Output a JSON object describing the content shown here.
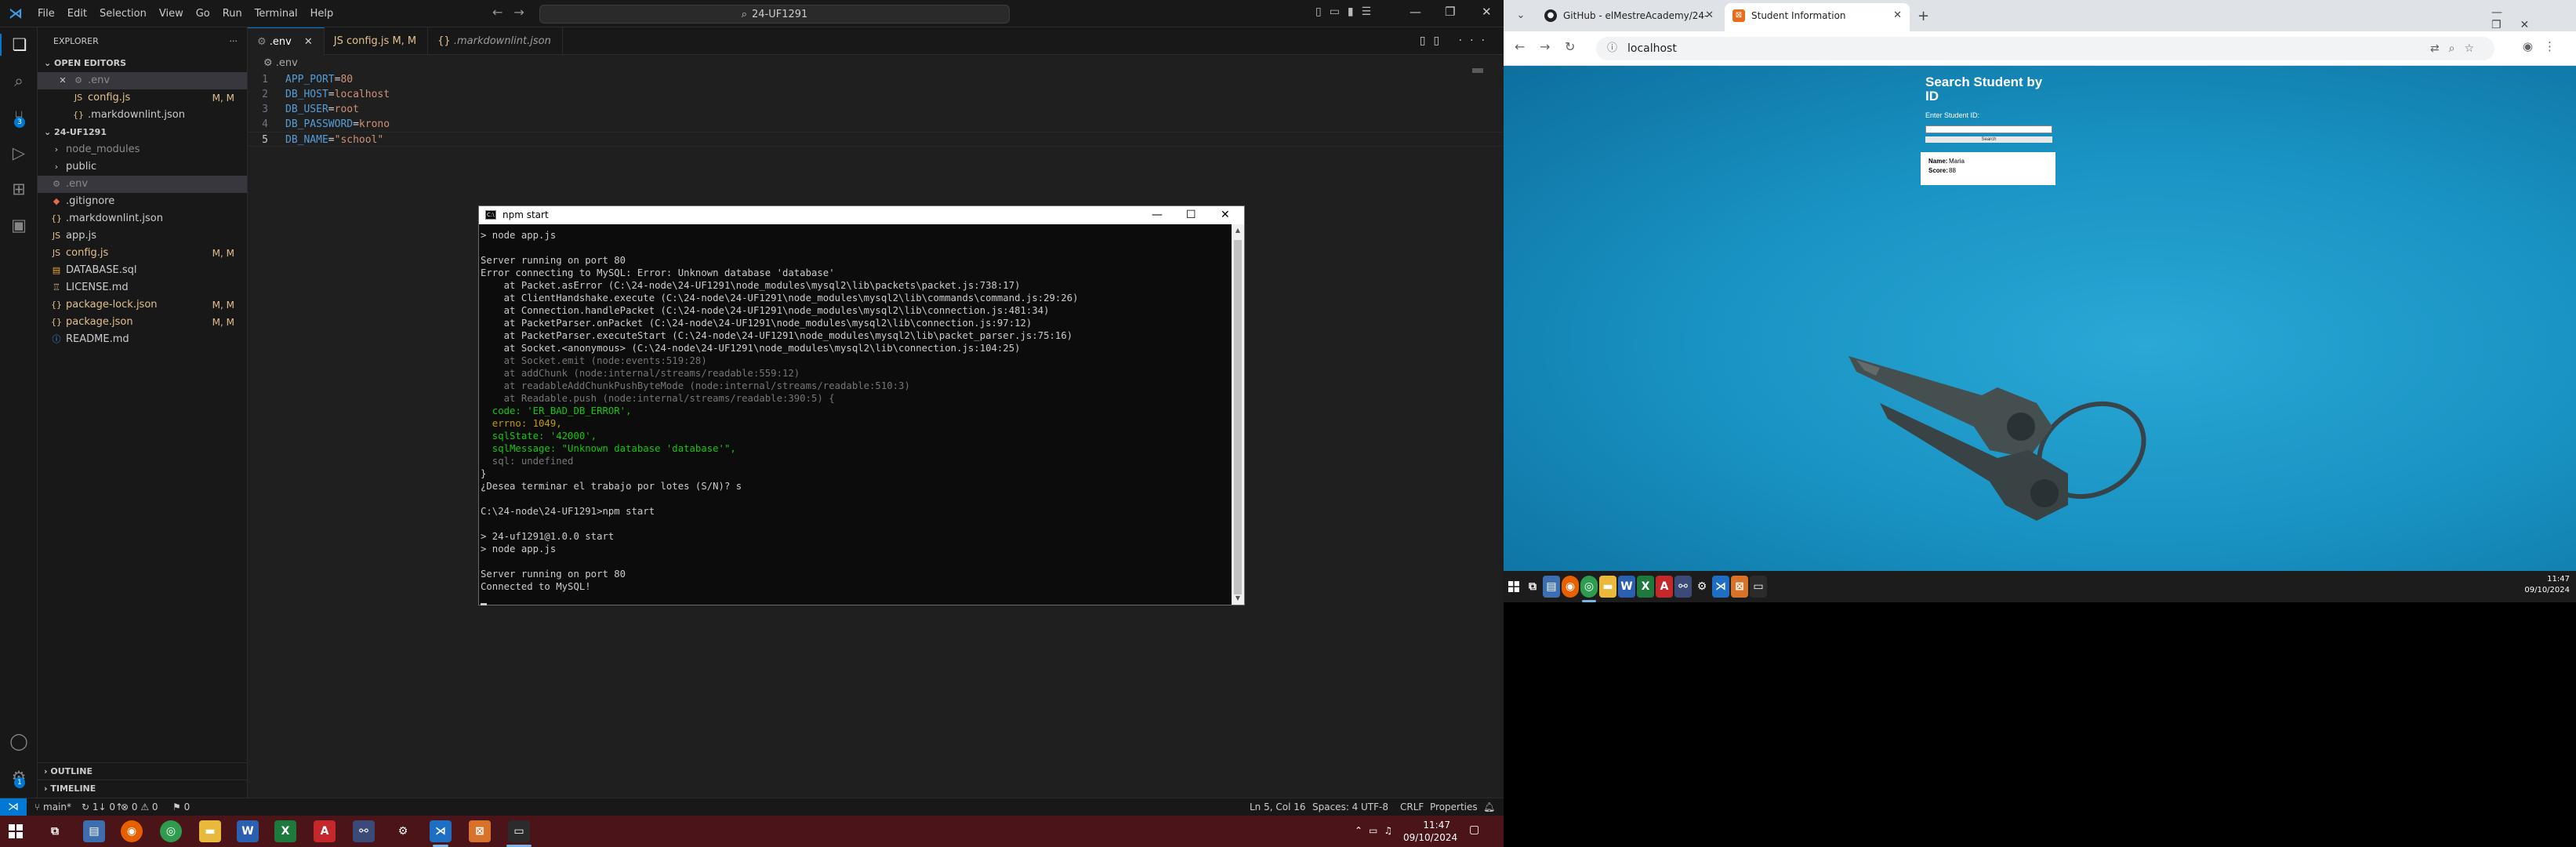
{
  "vscode": {
    "menu": [
      "File",
      "Edit",
      "Selection",
      "View",
      "Go",
      "Run",
      "Terminal",
      "Help"
    ],
    "search_box": "24-UF1291",
    "explorer_title": "EXPLORER",
    "open_editors_label": "OPEN EDITORS",
    "open_editors": [
      {
        "name": ".env",
        "status": "",
        "active": true
      },
      {
        "name": "config.js",
        "status": "M, M"
      },
      {
        "name": ".markdownlint.json",
        "status": ""
      }
    ],
    "workspace_label": "24-UF1291",
    "tree": [
      {
        "name": "node_modules",
        "type": "folder"
      },
      {
        "name": "public",
        "type": "folder"
      },
      {
        "name": ".env",
        "type": "file",
        "selected": true
      },
      {
        "name": ".gitignore",
        "type": "file"
      },
      {
        "name": ".markdownlint.json",
        "type": "file"
      },
      {
        "name": "app.js",
        "type": "file"
      },
      {
        "name": "config.js",
        "type": "file",
        "status": "M, M"
      },
      {
        "name": "DATABASE.sql",
        "type": "file"
      },
      {
        "name": "LICENSE.md",
        "type": "file"
      },
      {
        "name": "package-lock.json",
        "type": "file",
        "status": "M, M"
      },
      {
        "name": "package.json",
        "type": "file",
        "status": "M, M"
      },
      {
        "name": "README.md",
        "type": "file"
      }
    ],
    "outline_label": "OUTLINE",
    "timeline_label": "TIMELINE",
    "tabs": [
      {
        "label": ".env",
        "active": true
      },
      {
        "label": "config.js",
        "status": "M, M"
      },
      {
        "label": ".markdownlint.json"
      }
    ],
    "breadcrumb": ".env",
    "code": [
      {
        "n": "1",
        "key": "APP_PORT",
        "val": "80"
      },
      {
        "n": "2",
        "key": "DB_HOST",
        "val": "localhost"
      },
      {
        "n": "3",
        "key": "DB_USER",
        "val": "root"
      },
      {
        "n": "4",
        "key": "DB_PASSWORD",
        "val": "krono"
      },
      {
        "n": "5",
        "key": "DB_NAME",
        "val": "\"school\""
      }
    ],
    "status": {
      "branch": "main*",
      "sync": "↻ 1↓ 0↑",
      "problems": "⊗ 0 ⚠ 0",
      "ports": "⚑ 0",
      "position": "Ln 5, Col 16",
      "spaces": "Spaces: 4",
      "encoding": "UTF-8",
      "eol": "CRLF",
      "lang": "Properties"
    }
  },
  "cmd": {
    "title": "npm start",
    "lines": [
      {
        "t": "> node app.js",
        "c": ""
      },
      {
        "t": "",
        "c": ""
      },
      {
        "t": "Server running on port 80",
        "c": ""
      },
      {
        "t": "Error connecting to MySQL: Error: Unknown database 'database'",
        "c": ""
      },
      {
        "t": "    at Packet.asError (C:\\24-node\\24-UF1291\\node_modules\\mysql2\\lib\\packets\\packet.js:738:17)",
        "c": "trace"
      },
      {
        "t": "    at ClientHandshake.execute (C:\\24-node\\24-UF1291\\node_modules\\mysql2\\lib\\commands\\command.js:29:26)",
        "c": "trace"
      },
      {
        "t": "    at Connection.handlePacket (C:\\24-node\\24-UF1291\\node_modules\\mysql2\\lib\\connection.js:481:34)",
        "c": "trace"
      },
      {
        "t": "    at PacketParser.onPacket (C:\\24-node\\24-UF1291\\node_modules\\mysql2\\lib\\connection.js:97:12)",
        "c": "trace"
      },
      {
        "t": "    at PacketParser.executeStart (C:\\24-node\\24-UF1291\\node_modules\\mysql2\\lib\\packet_parser.js:75:16)",
        "c": "trace"
      },
      {
        "t": "    at Socket.<anonymous> (C:\\24-node\\24-UF1291\\node_modules\\mysql2\\lib\\connection.js:104:25)",
        "c": "trace"
      },
      {
        "t": "    at Socket.emit (node:events:519:28)",
        "c": "gray"
      },
      {
        "t": "    at addChunk (node:internal/streams/readable:559:12)",
        "c": "gray"
      },
      {
        "t": "    at readableAddChunkPushByteMode (node:internal/streams/readable:510:3)",
        "c": "gray"
      },
      {
        "t": "    at Readable.push (node:internal/streams/readable:390:5) {",
        "c": "gray"
      },
      {
        "t": "  code: 'ER_BAD_DB_ERROR',",
        "c": "code"
      },
      {
        "t": "  errno: 1049,",
        "c": "errno"
      },
      {
        "t": "  sqlState: '42000',",
        "c": "state"
      },
      {
        "t": "  sqlMessage: \"Unknown database 'database'\",",
        "c": "msg"
      },
      {
        "t": "  sql: undefined",
        "c": "sql"
      },
      {
        "t": "}",
        "c": ""
      },
      {
        "t": "¿Desea terminar el trabajo por lotes (S/N)? s",
        "c": ""
      },
      {
        "t": "",
        "c": ""
      },
      {
        "t": "C:\\24-node\\24-UF1291>npm start",
        "c": ""
      },
      {
        "t": "",
        "c": ""
      },
      {
        "t": "> 24-uf1291@1.0.0 start",
        "c": ""
      },
      {
        "t": "> node app.js",
        "c": ""
      },
      {
        "t": "",
        "c": ""
      },
      {
        "t": "Server running on port 80",
        "c": ""
      },
      {
        "t": "Connected to MySQL!",
        "c": ""
      }
    ]
  },
  "chrome": {
    "tabs": [
      {
        "label": "GitHub - elMestreAcademy/24-",
        "active": false
      },
      {
        "label": "Student Information",
        "active": true
      }
    ],
    "url": "localhost",
    "page": {
      "heading": "Search Student by ID",
      "input_label": "Enter Student ID:",
      "button": "Search",
      "result": [
        {
          "k": "Name:",
          "v": "Maria"
        },
        {
          "k": "Score:",
          "v": "88"
        }
      ]
    }
  },
  "taskbar_left": {
    "time": "11:47",
    "date": "09/10/2024"
  },
  "taskbar_right": {
    "time": "11:47",
    "date": "09/10/2024"
  },
  "colors": {
    "accent": "#0078d4",
    "taskbar_left": "#4a1419",
    "page_bg": "#1a94c4"
  }
}
